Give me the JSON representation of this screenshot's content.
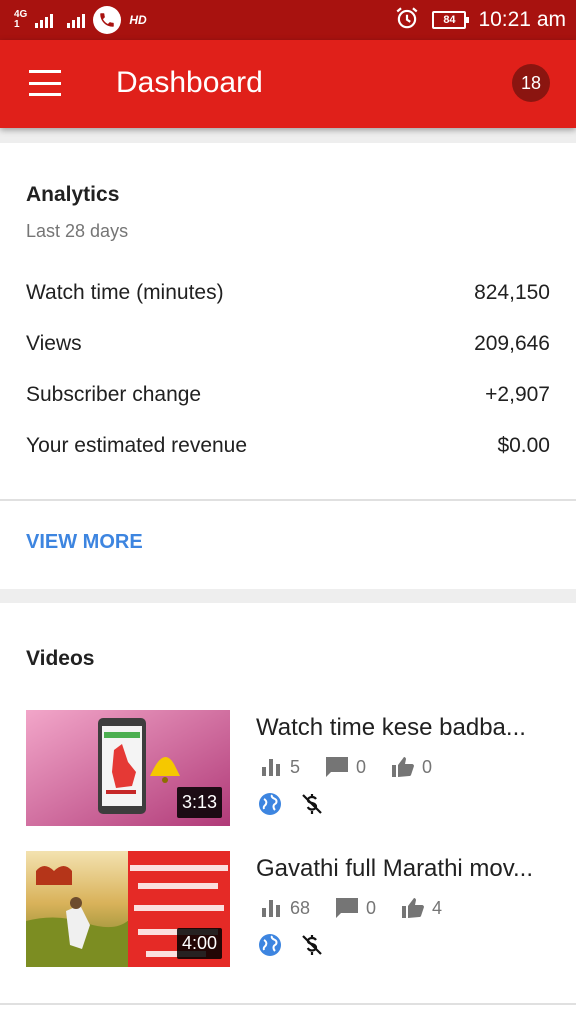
{
  "status_bar": {
    "network_label": "4G",
    "network_sub": "1",
    "hd_label": "HD",
    "battery": "84",
    "time": "10:21 am"
  },
  "app_bar": {
    "title": "Dashboard",
    "notification_count": "18",
    "color": "#e0201a"
  },
  "analytics": {
    "title": "Analytics",
    "subtitle": "Last 28 days",
    "metrics": [
      {
        "label": "Watch time (minutes)",
        "value": "824,150"
      },
      {
        "label": "Views",
        "value": "209,646"
      },
      {
        "label": "Subscriber change",
        "value": "+2,907"
      },
      {
        "label": "Your estimated revenue",
        "value": "$0.00"
      }
    ],
    "view_more_label": "VIEW MORE",
    "link_color": "#3d85e0"
  },
  "videos": {
    "title": "Videos",
    "items": [
      {
        "title": "Watch time kese badba...",
        "duration": "3:13",
        "views": "5",
        "comments": "0",
        "likes": "0",
        "visibility_icon": "globe-icon",
        "monetization_icon": "no-monetization-icon"
      },
      {
        "title": "Gavathi full Marathi mov...",
        "duration": "4:00",
        "views": "68",
        "comments": "0",
        "likes": "4",
        "visibility_icon": "globe-icon",
        "monetization_icon": "no-monetization-icon"
      }
    ]
  }
}
